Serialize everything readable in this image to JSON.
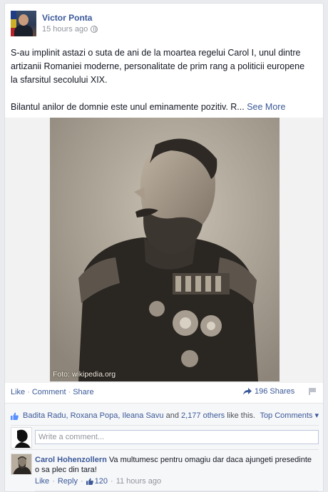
{
  "post": {
    "author": "Victor Ponta",
    "time": "15 hours ago",
    "paragraph1": "S-au implinit astazi o suta de ani de la moartea regelui Carol I, unul dintre artizanii Romaniei moderne, personalitate de prim rang a politicii europene la sfarsitul secolului XIX.",
    "paragraph2": "Bilantul anilor de domnie este unul eminamente pozitiv. R...",
    "see_more": "See More",
    "photo_caption": "Foto: wikipedia.org",
    "photo_icon": "king-carol-portrait"
  },
  "actions": {
    "like": "Like",
    "comment": "Comment",
    "share": "Share",
    "shares": "196 Shares"
  },
  "likes": {
    "names": "Badita Radu, Roxana Popa, Ileana Savu",
    "and": "and",
    "others": "2,177 others",
    "suffix": "like this.",
    "top_comments": "Top Comments ▾"
  },
  "write_comment": {
    "placeholder": "Write a comment..."
  },
  "comment": {
    "author": "Carol Hohenzollern",
    "text": "Va multumesc pentru omagiu dar daca ajungeti presedinte o sa plec din tara!",
    "like": "Like",
    "reply": "Reply",
    "likes": "120",
    "time": "11 hours ago"
  },
  "colors": {
    "link": "#3b5998",
    "muted": "#90949c",
    "ufi_bg": "#f6f7f9"
  }
}
